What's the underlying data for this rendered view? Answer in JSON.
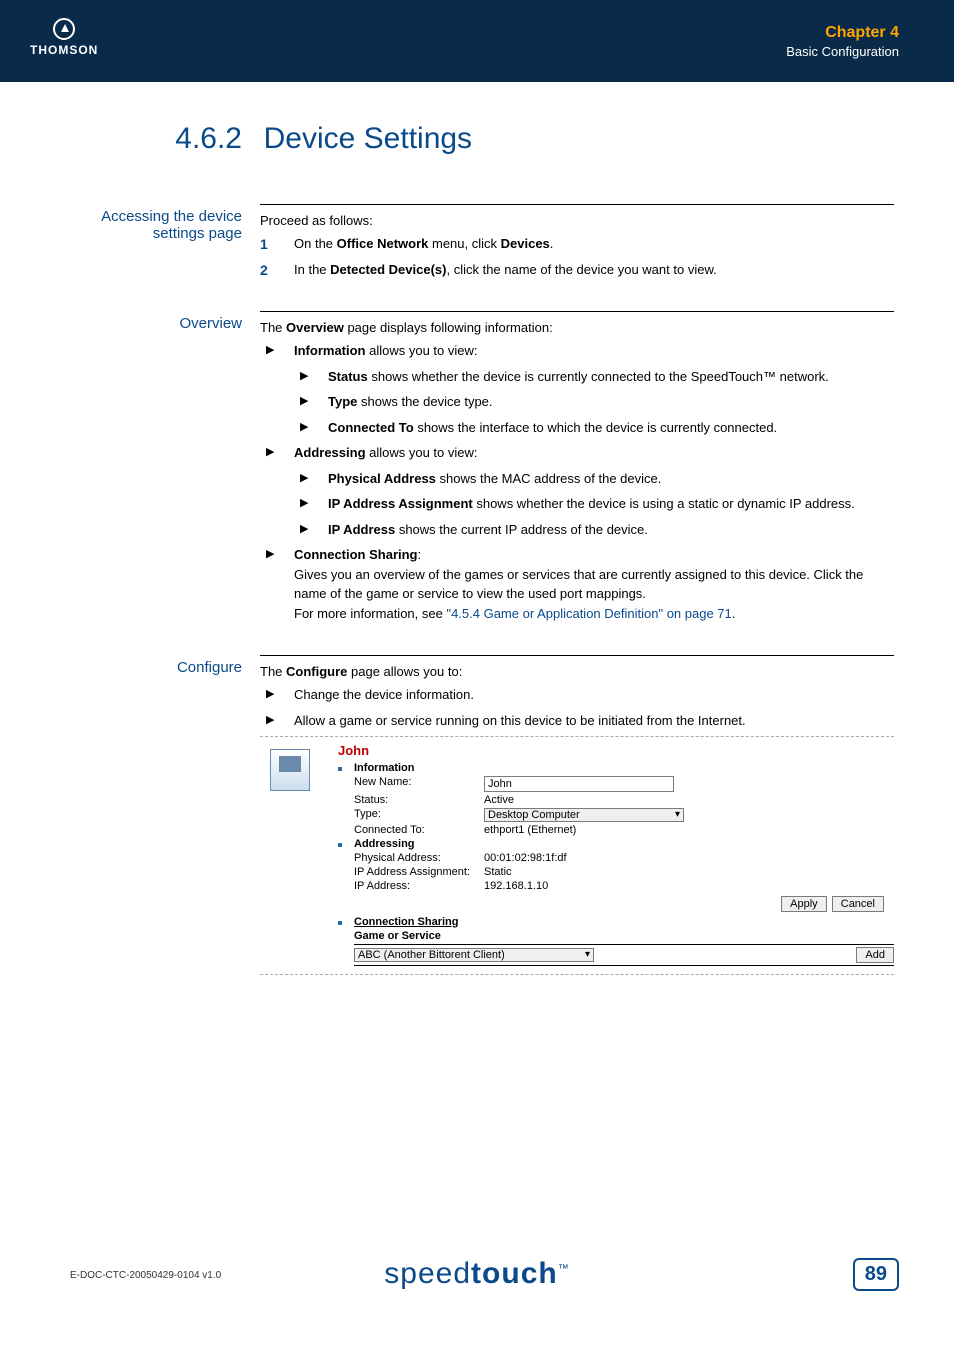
{
  "header": {
    "logo": "THOMSON",
    "chapter": "Chapter 4",
    "subtitle": "Basic Configuration"
  },
  "section": {
    "number": "4.6.2",
    "title": "Device Settings"
  },
  "accessing": {
    "heading": "Accessing the device settings page",
    "lead": "Proceed as follows:",
    "step1_pre": "On the ",
    "step1_b1": "Office Network",
    "step1_mid": " menu, click ",
    "step1_b2": "Devices",
    "step1_post": ".",
    "step2_pre": "In the ",
    "step2_b1": "Detected Device(s)",
    "step2_post": ", click the name of the device you want to view."
  },
  "overview": {
    "heading": "Overview",
    "lead_pre": "The ",
    "lead_b": "Overview",
    "lead_post": " page displays following information:",
    "info_b": "Information",
    "info_post": " allows you to view:",
    "status_b": "Status",
    "status_post": " shows whether the device is currently connected to the SpeedTouch™ network.",
    "type_b": "Type",
    "type_post": " shows the device type.",
    "conn_b": "Connected To",
    "conn_post": " shows the interface to which the device is currently connected.",
    "addr_b": "Addressing",
    "addr_post": " allows you to view:",
    "phys_b": "Physical Address",
    "phys_post": " shows the MAC address of the device.",
    "ipasgn_b": "IP Address Assignment",
    "ipasgn_post": " shows whether the device is using a static or dynamic IP address.",
    "ip_b": "IP Address",
    "ip_post": " shows the current IP address of the device.",
    "cs_b": "Connection Sharing",
    "cs_colon": ":",
    "cs_text": "Gives you an overview of the games or services that are currently assigned to this device. Click the name of the game or service to view the used port mappings.",
    "cs_more_pre": "For more information, see ",
    "cs_link": "\"4.5.4 Game or Application Definition\" on page 71",
    "cs_more_post": "."
  },
  "configure": {
    "heading": "Configure",
    "lead_pre": "The ",
    "lead_b": "Configure",
    "lead_post": " page allows you to:",
    "b1": "Change the device information.",
    "b2": "Allow a game or service running on this device to be initiated from the Internet."
  },
  "panel": {
    "device_name": "John",
    "sec_info": "Information",
    "newname_lbl": "New Name:",
    "newname_val": "John",
    "status_lbl": "Status:",
    "status_val": "Active",
    "type_lbl": "Type:",
    "type_val": "Desktop Computer",
    "connto_lbl": "Connected To:",
    "connto_val": "ethport1 (Ethernet)",
    "sec_addr": "Addressing",
    "phys_lbl": "Physical Address:",
    "phys_val": "00:01:02:98:1f:df",
    "ipasgn_lbl": "IP Address Assignment:",
    "ipasgn_val": "Static",
    "ip_lbl": "IP Address:",
    "ip_val": "192.168.1.10",
    "apply": "Apply",
    "cancel": "Cancel",
    "sec_cs": "Connection Sharing",
    "cs_col": "Game or Service",
    "cs_select": "ABC (Another Bittorent Client)",
    "add": "Add"
  },
  "footer": {
    "docid": "E-DOC-CTC-20050429-0104 v1.0",
    "brand1": "speed",
    "brand2": "touch",
    "tm": "™",
    "page": "89"
  }
}
